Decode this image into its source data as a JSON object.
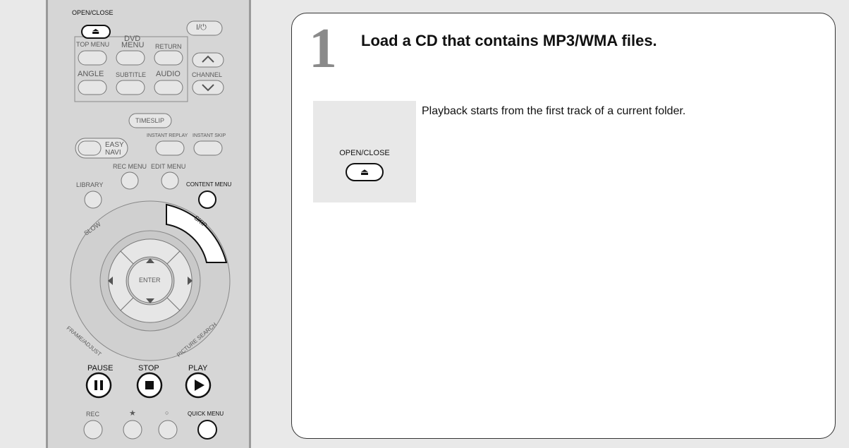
{
  "remote": {
    "labels": {
      "open_close": "OPEN/CLOSE",
      "power": "I/⏻",
      "dvd": "DVD",
      "top_menu": "TOP MENU",
      "menu": "MENU",
      "return": "RETURN",
      "angle": "ANGLE",
      "subtitle": "SUBTITLE",
      "audio": "AUDIO",
      "channel": "CHANNEL",
      "timeslip": "TIMESLIP",
      "easy_navi": "EASY NAVI",
      "instant_replay": "INSTANT REPLAY",
      "instant_skip": "INSTANT SKIP",
      "rec_menu": "REC MENU",
      "edit_menu": "EDIT MENU",
      "library": "LIBRARY",
      "content_menu": "CONTENT MENU",
      "slow": "SLOW",
      "skip": "SKIP",
      "enter": "ENTER",
      "frame_adjust": "FRAME/ADJUST",
      "picture_search": "PICTURE SEARCH",
      "pause": "PAUSE",
      "stop": "STOP",
      "play": "PLAY",
      "rec": "REC",
      "star": "★",
      "circle": "○",
      "quick_menu": "QUICK MENU"
    }
  },
  "step": {
    "number": "1",
    "title": "Load a CD that contains MP3/WMA files.",
    "button_label": "OPEN/CLOSE",
    "button_symbol": "⏏",
    "description": "Playback starts from the first track of a current folder."
  }
}
